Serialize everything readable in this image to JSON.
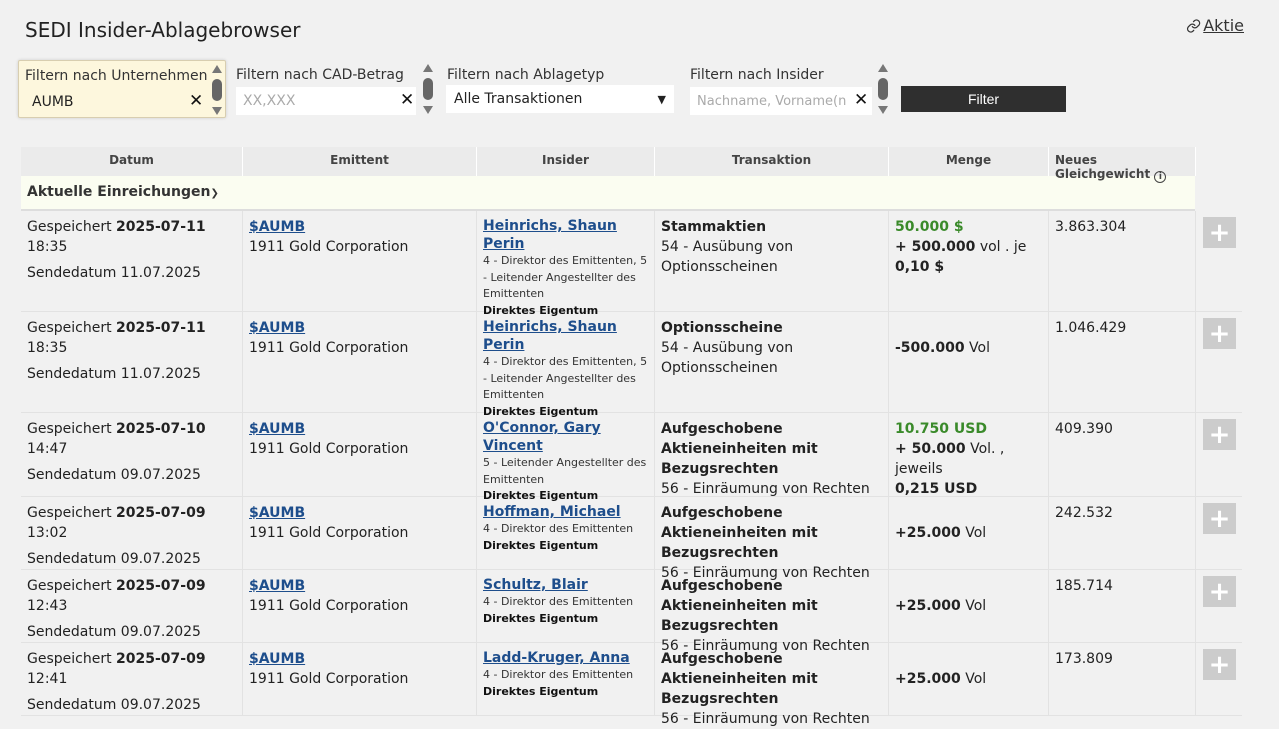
{
  "title": "SEDI Insider-Ablagebrowser",
  "aktie_label": "Aktie",
  "filters": {
    "company": {
      "label": "Filtern nach Unternehmen",
      "value": "AUMB"
    },
    "cad": {
      "label": "Filtern nach CAD-Betrag",
      "placeholder": "XX,XXX"
    },
    "type": {
      "label": "Filtern nach Ablagetyp",
      "selected": "Alle Transaktionen"
    },
    "insider": {
      "label": "Filtern nach Insider",
      "placeholder": "Nachname, Vorname(n)"
    },
    "button_label": "Filter"
  },
  "table": {
    "headers": {
      "datum": "Datum",
      "emittent": "Emittent",
      "insider": "Insider",
      "transaktion": "Transaktion",
      "menge": "Menge",
      "gleichgewicht": "Neues Gleichgewicht"
    },
    "group_label": "Aktuelle Einreichungen",
    "rows": [
      {
        "saved_prefix": "Gespeichert",
        "saved_date": "2025-07-11",
        "saved_time": "18:35",
        "send_date": "Sendedatum 11.07.2025",
        "ticker": "$AUMB",
        "issuer": "1911 Gold Corporation",
        "insider": "Heinrichs, Shaun Perin",
        "role": "4 - Direktor des Emittenten, 5 - Leitender Angestellter des Emittenten",
        "ownership": "Direktes Eigentum",
        "security": "Stammaktien",
        "tx_type": "54 - Ausübung von Optionsscheinen",
        "amount_green": "50.000 $",
        "amount_strong": "+ 500.000",
        "amount_text": " vol . je",
        "amount_extra": "0,10 $",
        "balance": "3.863.304"
      },
      {
        "saved_prefix": "Gespeichert",
        "saved_date": "2025-07-11",
        "saved_time": "18:35",
        "send_date": "Sendedatum 11.07.2025",
        "ticker": "$AUMB",
        "issuer": "1911 Gold Corporation",
        "insider": "Heinrichs, Shaun Perin",
        "role": "4 - Direktor des Emittenten, 5 - Leitender Angestellter des Emittenten",
        "ownership": "Direktes Eigentum",
        "security": "Optionsscheine",
        "tx_type": "54 - Ausübung von Optionsscheinen",
        "amount_green": "",
        "amount_strong": "-500.000",
        "amount_text": " Vol",
        "amount_extra": "",
        "balance": "1.046.429"
      },
      {
        "saved_prefix": "Gespeichert",
        "saved_date": "2025-07-10",
        "saved_time": "14:47",
        "send_date": "Sendedatum 09.07.2025",
        "ticker": "$AUMB",
        "issuer": "1911 Gold Corporation",
        "insider": "O'Connor, Gary Vincent",
        "role": "5 - Leitender Angestellter des Emittenten",
        "ownership": "Direktes Eigentum",
        "security": "Aufgeschobene Aktieneinheiten mit Bezugsrechten",
        "tx_type": "56 - Einräumung von Rechten",
        "amount_green": "10.750 USD",
        "amount_strong": "+ 50.000",
        "amount_text": " Vol. , jeweils",
        "amount_extra": "0,215 USD",
        "balance": "409.390"
      },
      {
        "saved_prefix": "Gespeichert",
        "saved_date": "2025-07-09",
        "saved_time": "13:02",
        "send_date": "Sendedatum 09.07.2025",
        "ticker": "$AUMB",
        "issuer": "1911 Gold Corporation",
        "insider": "Hoffman, Michael",
        "role": "4 - Direktor des Emittenten",
        "ownership": "Direktes Eigentum",
        "security": "Aufgeschobene Aktieneinheiten mit Bezugsrechten",
        "tx_type": "56 - Einräumung von Rechten",
        "amount_green": "",
        "amount_strong": "+25.000",
        "amount_text": " Vol",
        "amount_extra": "",
        "balance": "242.532"
      },
      {
        "saved_prefix": "Gespeichert",
        "saved_date": "2025-07-09",
        "saved_time": "12:43",
        "send_date": "Sendedatum 09.07.2025",
        "ticker": "$AUMB",
        "issuer": "1911 Gold Corporation",
        "insider": "Schultz, Blair",
        "role": "4 - Direktor des Emittenten",
        "ownership": "Direktes Eigentum",
        "security": "Aufgeschobene Aktieneinheiten mit Bezugsrechten",
        "tx_type": "56 - Einräumung von Rechten",
        "amount_green": "",
        "amount_strong": "+25.000",
        "amount_text": " Vol",
        "amount_extra": "",
        "balance": "185.714"
      },
      {
        "saved_prefix": "Gespeichert",
        "saved_date": "2025-07-09",
        "saved_time": "12:41",
        "send_date": "Sendedatum 09.07.2025",
        "ticker": "$AUMB",
        "issuer": "1911 Gold Corporation",
        "insider": "Ladd-Kruger, Anna",
        "role": "4 - Direktor des Emittenten",
        "ownership": "Direktes Eigentum",
        "security": "Aufgeschobene Aktieneinheiten mit Bezugsrechten",
        "tx_type": "56 - Einräumung von Rechten",
        "amount_green": "",
        "amount_strong": "+25.000",
        "amount_text": " Vol",
        "amount_extra": "",
        "balance": "173.809"
      }
    ]
  },
  "colors": {
    "link": "#1e4e8c",
    "positive": "#3a8a2a",
    "button": "#2f2f2f",
    "highlight": "#fdf7dd"
  },
  "icons": {
    "aktie": "link-icon",
    "clear": "close-icon",
    "info": "info-icon",
    "add": "plus-icon",
    "group": "chevron-down-icon"
  }
}
